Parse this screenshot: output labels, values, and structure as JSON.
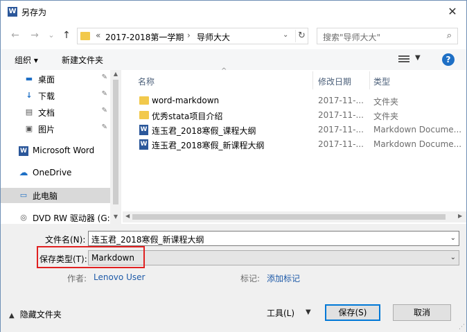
{
  "title": {
    "icon": "W",
    "text": "另存为",
    "close": "✕"
  },
  "address": {
    "back": "←",
    "forward": "→",
    "dropdown": "⌄",
    "up": "↑",
    "overflow": "«",
    "crumbs": [
      "2017-2018第一学期",
      "导师大大"
    ],
    "separator": "›",
    "refresh": "↻"
  },
  "search": {
    "placeholder": "搜索\"导师大大\""
  },
  "toolbar": {
    "organize": "组织 ▾",
    "new_folder": "新建文件夹",
    "help": "?"
  },
  "nav": {
    "items": [
      {
        "label": "桌面",
        "icon": "desktop-icon",
        "glyph": "▬",
        "pinned": true
      },
      {
        "label": "下载",
        "icon": "download-icon",
        "glyph": "↓",
        "pinned": true
      },
      {
        "label": "文档",
        "icon": "document-icon",
        "glyph": "▤",
        "pinned": true
      },
      {
        "label": "图片",
        "icon": "picture-icon",
        "glyph": "▣",
        "pinned": true
      },
      {
        "label": "Microsoft Word",
        "icon": "word-icon",
        "glyph": "W",
        "pinned": false
      },
      {
        "label": "OneDrive",
        "icon": "cloud-icon",
        "glyph": "☁",
        "pinned": false
      },
      {
        "label": "此电脑",
        "icon": "computer-icon",
        "glyph": "▭",
        "pinned": false
      },
      {
        "label": "DVD RW 驱动器 (G:)",
        "icon": "dvd-icon",
        "glyph": "◎",
        "pinned": false
      }
    ],
    "pin_glyph": "📌"
  },
  "columns": {
    "name": "名称",
    "modified": "修改日期",
    "type": "类型",
    "sort_glyph": "^"
  },
  "files": [
    {
      "name": "word-markdown",
      "date": "2017-11-...",
      "type": "文件夹",
      "kind": "folder"
    },
    {
      "name": "优秀stata项目介绍",
      "date": "2017-11-...",
      "type": "文件夹",
      "kind": "folder"
    },
    {
      "name": "连玉君_2018寒假_课程大纲",
      "date": "2017-11-...",
      "type": "Markdown Docume...",
      "kind": "word"
    },
    {
      "name": "连玉君_2018寒假_新课程大纲",
      "date": "2017-11-...",
      "type": "Markdown Docume...",
      "kind": "word"
    }
  ],
  "form": {
    "filename_label": "文件名(N):",
    "filename_value": "连玉君_2018寒假_新课程大纲",
    "savetype_label": "保存类型(T):",
    "savetype_value": "Markdown",
    "author_label": "作者:",
    "author_value": "Lenovo User",
    "tags_label": "标记:",
    "tags_value": "添加标记"
  },
  "footer": {
    "hide_folders": "隐藏文件夹",
    "tools": "工具(L)",
    "save": "保存(S)",
    "cancel": "取消"
  },
  "colors": {
    "highlight_box": "#e02020",
    "link": "#1e5aa8",
    "selected_nav": "#d9d9d9"
  }
}
